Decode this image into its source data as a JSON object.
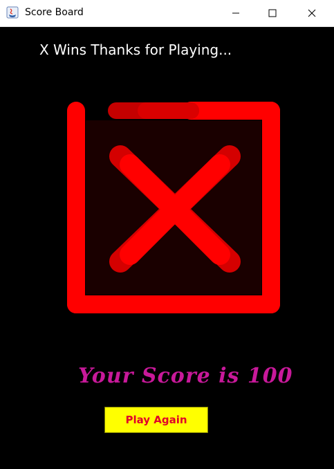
{
  "window": {
    "title": "Score Board"
  },
  "headline": "X Wins  Thanks for Playing...",
  "score_text": "Your Score is 100",
  "play_again_label": "Play Again",
  "colors": {
    "background": "#000000",
    "x_mark": "#ff0000",
    "score_text": "#c8199a",
    "button_bg": "#ffff00",
    "button_text": "#e0002a"
  },
  "icons": [
    "java-app-icon",
    "minimize-icon",
    "maximize-icon",
    "close-icon",
    "x-mark-icon"
  ]
}
